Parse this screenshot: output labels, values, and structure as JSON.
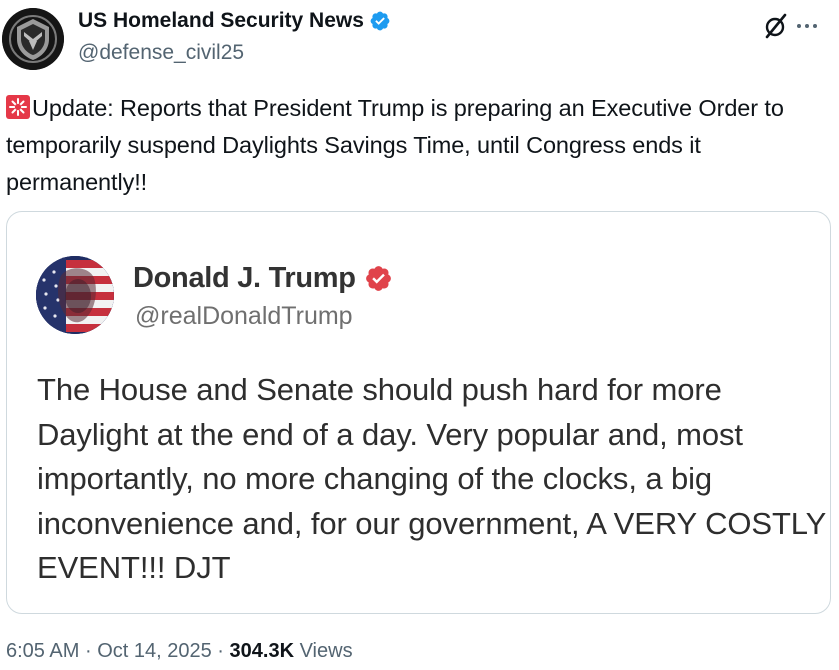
{
  "post": {
    "author_name": "US Homeland Security News",
    "author_handle": "@defense_civil25",
    "text": "Update: Reports that President Trump is preparing an Executive Order to temporarily suspend Daylights Savings Time, until Congress ends it permanently!!",
    "icons": [
      "shield-logo-icon",
      "verified-badge-icon",
      "grok-icon",
      "more-icon",
      "siren-icon"
    ]
  },
  "quote": {
    "author_name": "Donald J. Trump",
    "author_handle": "@realDonaldTrump",
    "text": "The House and Senate should push hard for more Daylight at the end of a day. Very popular and, most importantly, no more changing of the clocks, a big inconvenience and, for our government, A VERY COSTLY EVENT!!! DJT",
    "icons": [
      "verified-badge-icon"
    ]
  },
  "meta": {
    "time": "6:05 AM",
    "separator": "·",
    "date": "Oct 14, 2025",
    "views_count": "304.3K",
    "views_label": "Views"
  },
  "colors": {
    "verified_blue": "#1d9bf0",
    "truth_badge_red": "#e0434b",
    "secondary_text": "#536471",
    "border": "#cfd9de"
  }
}
